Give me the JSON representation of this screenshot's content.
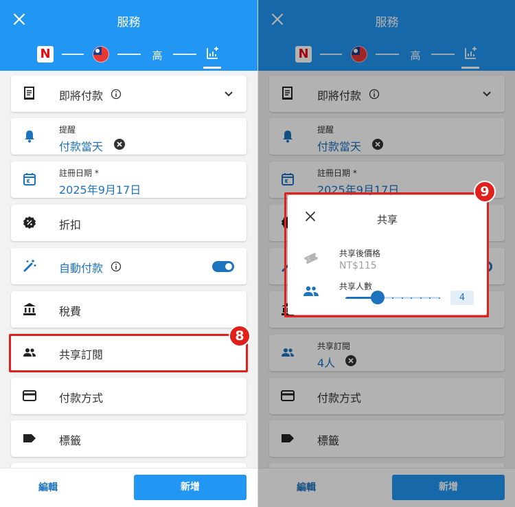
{
  "header": {
    "title": "服務",
    "steps": {
      "brand_letter": "N",
      "level_label": "高"
    }
  },
  "left_panel": {
    "items": {
      "upcoming_payment": {
        "label": "即將付款"
      },
      "reminder": {
        "label": "提醒",
        "value": "付款當天"
      },
      "signup_date": {
        "label": "註冊日期 *",
        "value": "2025年9月17日"
      },
      "discount": {
        "label": "折扣"
      },
      "auto_payment": {
        "label": "自動付款",
        "enabled": true
      },
      "tax": {
        "label": "稅費"
      },
      "shared_subscription": {
        "label": "共享訂閱"
      },
      "payment_method": {
        "label": "付款方式"
      },
      "tags": {
        "label": "標籤"
      }
    },
    "step_badge": "8"
  },
  "right_panel": {
    "items": {
      "shared_subscription": {
        "label": "共享訂閱",
        "value": "4人"
      }
    },
    "step_badge": "9",
    "dialog": {
      "title": "共享",
      "price_label": "共享後價格",
      "price_value": "NT$115",
      "people_label": "共享人數",
      "people_count": "4",
      "slider": {
        "value": 4,
        "max": 10
      }
    }
  },
  "bottom_bar": {
    "edit_label": "編輯",
    "add_label": "新增"
  },
  "colors": {
    "header": "#2196f3",
    "accent": "#1e73be",
    "highlight": "#e0201b"
  }
}
